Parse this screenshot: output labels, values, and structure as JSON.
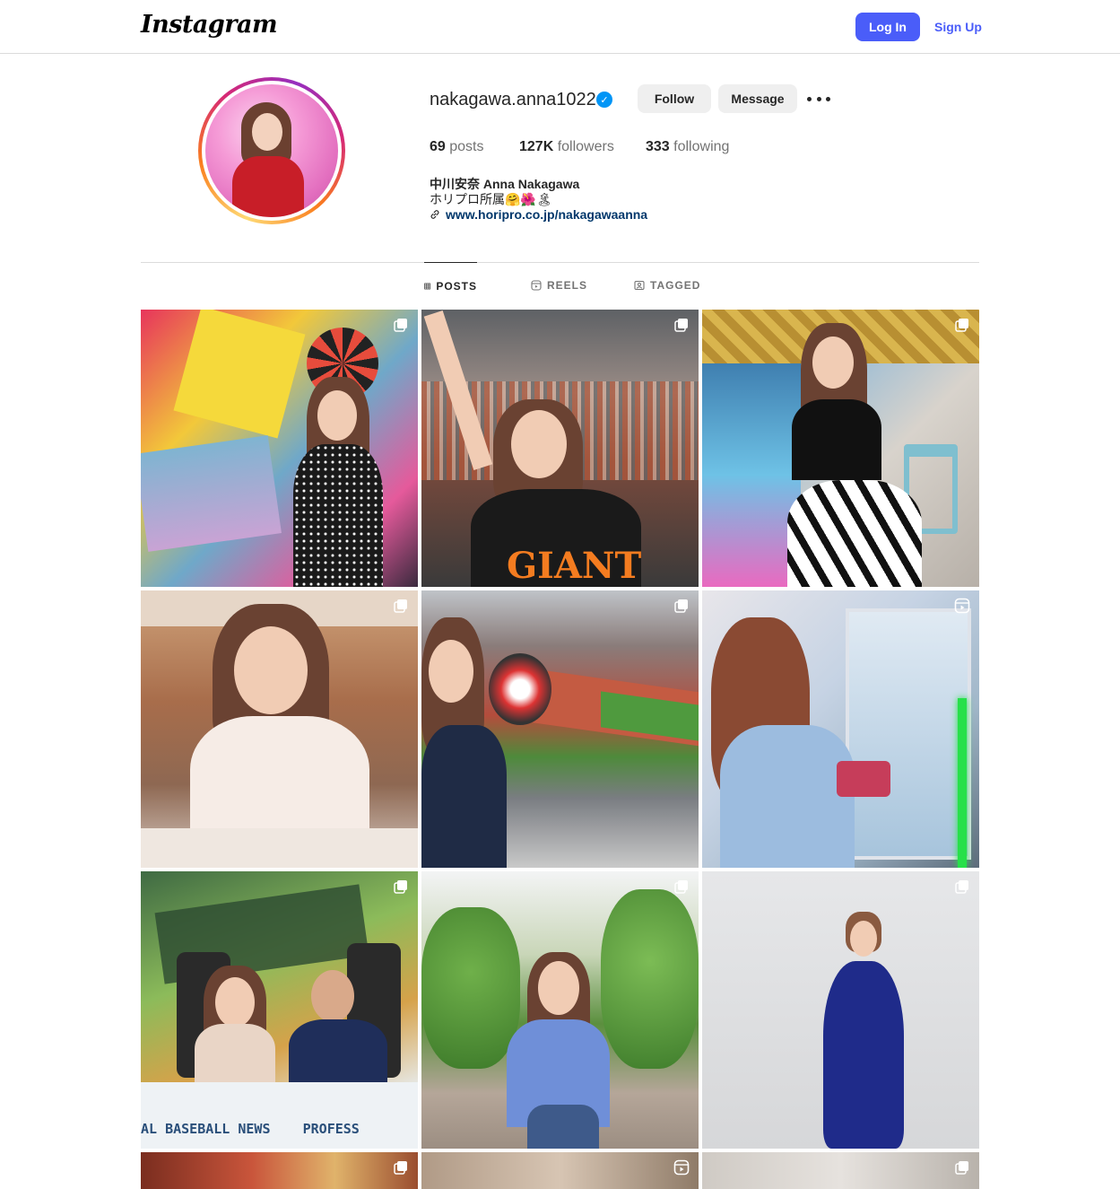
{
  "nav": {
    "logo": "Instagram",
    "login_label": "Log In",
    "signup_label": "Sign Up"
  },
  "profile": {
    "username": "nakagawa.anna1022",
    "follow_label": "Follow",
    "message_label": "Message",
    "stats": {
      "posts_count": "69",
      "posts_label": "posts",
      "followers_count": "127K",
      "followers_label": "followers",
      "following_count": "333",
      "following_label": "following"
    },
    "bio": {
      "name": "中川安奈 Anna Nakagawa",
      "line": "ホリプロ所属🤗🌺🏝",
      "link": "www.horipro.co.jp/nakagawaanna"
    }
  },
  "tabs": [
    {
      "label": "POSTS",
      "active": true
    },
    {
      "label": "REELS",
      "active": false
    },
    {
      "label": "TAGGED",
      "active": false
    }
  ],
  "posts": [
    {
      "type": "carousel",
      "scene": "colorful-game-set"
    },
    {
      "type": "carousel",
      "scene": "baseball-stadium-cheer"
    },
    {
      "type": "carousel",
      "scene": "neon-cafe"
    },
    {
      "type": "carousel",
      "scene": "restaurant-portrait"
    },
    {
      "type": "carousel",
      "scene": "stadium-with-fan"
    },
    {
      "type": "reel",
      "scene": "claw-machine"
    },
    {
      "type": "carousel",
      "scene": "baseball-news-studio"
    },
    {
      "type": "carousel",
      "scene": "strawberry-greenhouse"
    },
    {
      "type": "carousel",
      "scene": "blue-dress-wall"
    },
    {
      "type": "carousel",
      "scene": "partial-row"
    },
    {
      "type": "reel",
      "scene": "partial-row"
    },
    {
      "type": "carousel",
      "scene": "partial-row"
    }
  ],
  "colors": {
    "primary_button": "#4a5df9",
    "link": "#00376b",
    "verified": "#0095f6"
  }
}
